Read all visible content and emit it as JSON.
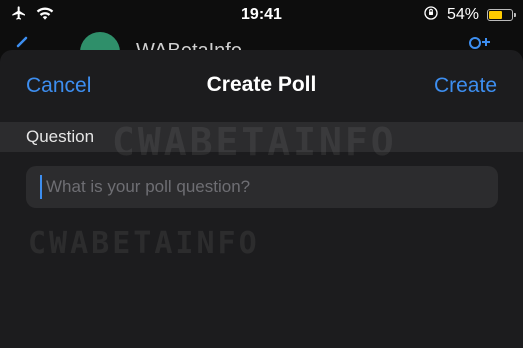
{
  "status_bar": {
    "time": "19:41",
    "battery_percent_label": "54%",
    "battery_level": 0.54,
    "icons": [
      "airplane-icon",
      "wifi-icon",
      "orientation-lock-icon",
      "battery-icon"
    ]
  },
  "chat_header": {
    "name": "WABetaInfo"
  },
  "poll": {
    "cancel_label": "Cancel",
    "title": "Create Poll",
    "create_label": "Create",
    "section_label": "Question",
    "question_value": "",
    "question_placeholder": "What is your poll question?"
  },
  "watermark": "CWABETAINFO",
  "colors": {
    "accent": "#3d8ef0",
    "sheet_bg": "#1c1c1e",
    "section_bg": "#2c2c2e",
    "battery": "#ffcc00"
  }
}
